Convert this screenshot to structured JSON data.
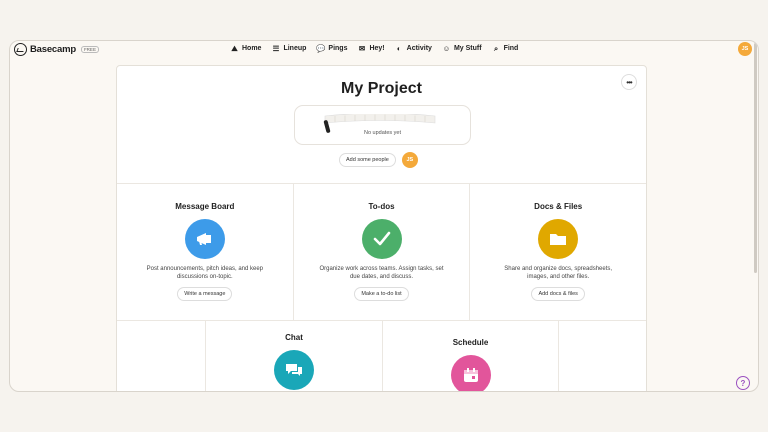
{
  "app": {
    "name": "Basecamp",
    "badge": "FREE"
  },
  "nav": [
    {
      "label": "Home",
      "icon": "home-icon",
      "glyph": "⛰"
    },
    {
      "label": "Lineup",
      "icon": "lineup-icon",
      "glyph": "☰"
    },
    {
      "label": "Pings",
      "icon": "pings-icon",
      "glyph": "💬"
    },
    {
      "label": "Hey!",
      "icon": "hey-icon",
      "glyph": "✉"
    },
    {
      "label": "Activity",
      "icon": "activity-icon",
      "glyph": "◐"
    },
    {
      "label": "My Stuff",
      "icon": "mystuff-icon",
      "glyph": "☺"
    },
    {
      "label": "Find",
      "icon": "find-icon",
      "glyph": "⌕"
    }
  ],
  "user": {
    "initials": "JS"
  },
  "project": {
    "title": "My Project",
    "updates_text": "No updates yet",
    "add_people": "Add some people"
  },
  "tools": [
    {
      "title": "Message Board",
      "desc": "Post announcements, pitch ideas, and keep discussions on-topic.",
      "action": "Write a message",
      "color": "#3d9be9",
      "icon": "megaphone-icon"
    },
    {
      "title": "To-dos",
      "desc": "Organize work across teams. Assign tasks, set due dates, and discuss.",
      "action": "Make a to-do list",
      "color": "#4caf6a",
      "icon": "checkmark-icon"
    },
    {
      "title": "Docs & Files",
      "desc": "Share and organize docs, spreadsheets, images, and other files.",
      "action": "Add docs & files",
      "color": "#e0a800",
      "icon": "folder-icon"
    }
  ],
  "bottom_tools": [
    {
      "title": "Chat",
      "color": "#1aa7b8",
      "icon": "chat-icon"
    },
    {
      "title": "Schedule",
      "color": "#e2559b",
      "icon": "calendar-icon"
    }
  ],
  "help": {
    "label": "?"
  }
}
